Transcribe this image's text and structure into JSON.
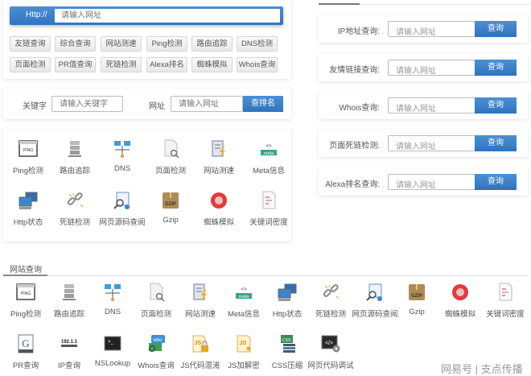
{
  "top_search": {
    "prefix": "Http://",
    "placeholder": "请输入网址"
  },
  "quick_buttons": [
    "友链查询",
    "综合查询",
    "网站测速",
    "Ping检测",
    "路由追踪",
    "DNS检测",
    "页面检测",
    "PR值查询",
    "死链检测",
    "Alexa排名",
    "蜘蛛模拟",
    "Whois查询"
  ],
  "rank_search": {
    "keyword_label": "关键字",
    "keyword_placeholder": "请输入关键字",
    "url_label": "网址",
    "url_placeholder": "请输入网址",
    "button": "查排名"
  },
  "tool_grid": [
    {
      "label": "Ping检测",
      "icon": "ping"
    },
    {
      "label": "路由追踪",
      "icon": "server"
    },
    {
      "label": "DNS",
      "icon": "dns"
    },
    {
      "label": "页面检测",
      "icon": "page-search"
    },
    {
      "label": "网站测速",
      "icon": "speed"
    },
    {
      "label": "Meta信息",
      "icon": "meta"
    },
    {
      "label": "Http状态",
      "icon": "http-status"
    },
    {
      "label": "死链检测",
      "icon": "broken-link"
    },
    {
      "label": "网页源码查阅",
      "icon": "source-view"
    },
    {
      "label": "Gzip",
      "icon": "gzip"
    },
    {
      "label": "蜘蛛模拟",
      "icon": "spider"
    },
    {
      "label": "关键词密度",
      "icon": "keyword-density"
    }
  ],
  "right_queries": [
    {
      "label": "IP地址查询:",
      "placeholder": "请输入网址",
      "button": "查询"
    },
    {
      "label": "友情链接查询:",
      "placeholder": "请输入网址",
      "button": "查询"
    },
    {
      "label": "Whois查询:",
      "placeholder": "请输入网址",
      "button": "查询"
    },
    {
      "label": "页面死链检测:",
      "placeholder": "请输入网址",
      "button": "查询"
    },
    {
      "label": "Alexa排名查询:",
      "placeholder": "请输入网址",
      "button": "查询"
    }
  ],
  "site_query": {
    "tab": "网站查询",
    "tools": [
      {
        "label": "Ping检测",
        "icon": "ping"
      },
      {
        "label": "路由追踪",
        "icon": "server"
      },
      {
        "label": "DNS",
        "icon": "dns"
      },
      {
        "label": "页面检测",
        "icon": "page-search"
      },
      {
        "label": "网站测速",
        "icon": "speed"
      },
      {
        "label": "Meta信息",
        "icon": "meta"
      },
      {
        "label": "Http状态",
        "icon": "http-status"
      },
      {
        "label": "死链检测",
        "icon": "broken-link"
      },
      {
        "label": "网页源码查阅",
        "icon": "source-view"
      },
      {
        "label": "Gzip",
        "icon": "gzip"
      },
      {
        "label": "蜘蛛模拟",
        "icon": "spider"
      },
      {
        "label": "关键词密度",
        "icon": "keyword-density"
      },
      {
        "label": "PR查询",
        "icon": "pr"
      },
      {
        "label": "IP查询",
        "icon": "ip"
      },
      {
        "label": "NSLookup",
        "icon": "terminal"
      },
      {
        "label": "Whois查询",
        "icon": "whois"
      },
      {
        "label": "JS代码混淆",
        "icon": "js-lock"
      },
      {
        "label": "JS加解密",
        "icon": "js-key"
      },
      {
        "label": "CSS压缩",
        "icon": "css"
      },
      {
        "label": "网页代码调试",
        "icon": "code-debug"
      }
    ]
  },
  "watermark": "网易号 | 支点传播",
  "colors": {
    "accent": "#3a7fc8",
    "button_border": "#d6d6d6",
    "text": "#555555"
  }
}
